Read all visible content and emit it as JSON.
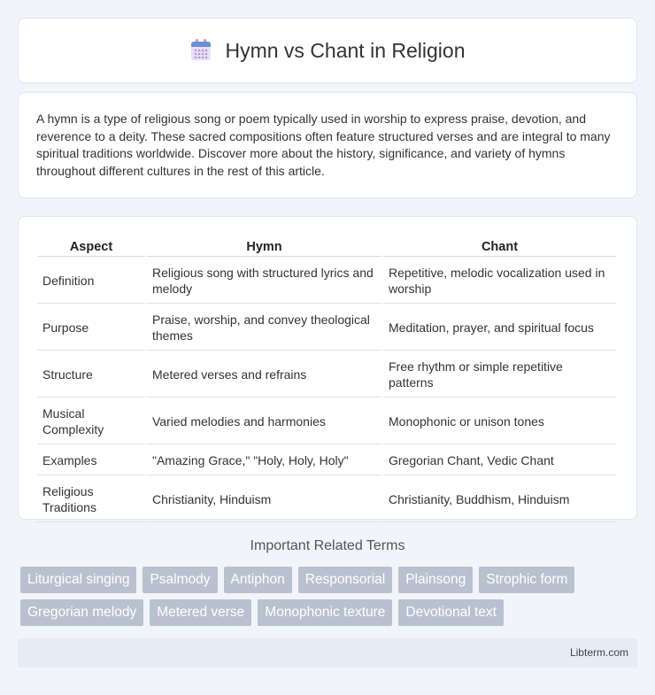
{
  "header": {
    "icon": "calendar-icon",
    "title": "Hymn vs Chant in Religion"
  },
  "intro": {
    "text": "A hymn is a type of religious song or poem typically used in worship to express praise, devotion, and reverence to a deity. These sacred compositions often feature structured verses and are integral to many spiritual traditions worldwide. Discover more about the history, significance, and variety of hymns throughout different cultures in the rest of this article."
  },
  "table": {
    "headers": [
      "Aspect",
      "Hymn",
      "Chant"
    ],
    "rows": [
      [
        "Definition",
        "Religious song with structured lyrics and melody",
        "Repetitive, melodic vocalization used in worship"
      ],
      [
        "Purpose",
        "Praise, worship, and convey theological themes",
        "Meditation, prayer, and spiritual focus"
      ],
      [
        "Structure",
        "Metered verses and refrains",
        "Free rhythm or simple repetitive patterns"
      ],
      [
        "Musical Complexity",
        "Varied melodies and harmonies",
        "Monophonic or unison tones"
      ],
      [
        "Examples",
        "\"Amazing Grace,\" \"Holy, Holy, Holy\"",
        "Gregorian Chant, Vedic Chant"
      ],
      [
        "Religious Traditions",
        "Christianity, Hinduism",
        "Christianity, Buddhism, Hinduism"
      ]
    ]
  },
  "related": {
    "title": "Important Related Terms",
    "tags": [
      "Liturgical singing",
      "Psalmody",
      "Antiphon",
      "Responsorial",
      "Plainsong",
      "Strophic form",
      "Gregorian melody",
      "Metered verse",
      "Monophonic texture",
      "Devotional text"
    ]
  },
  "footer": {
    "site": "Libterm.com"
  }
}
